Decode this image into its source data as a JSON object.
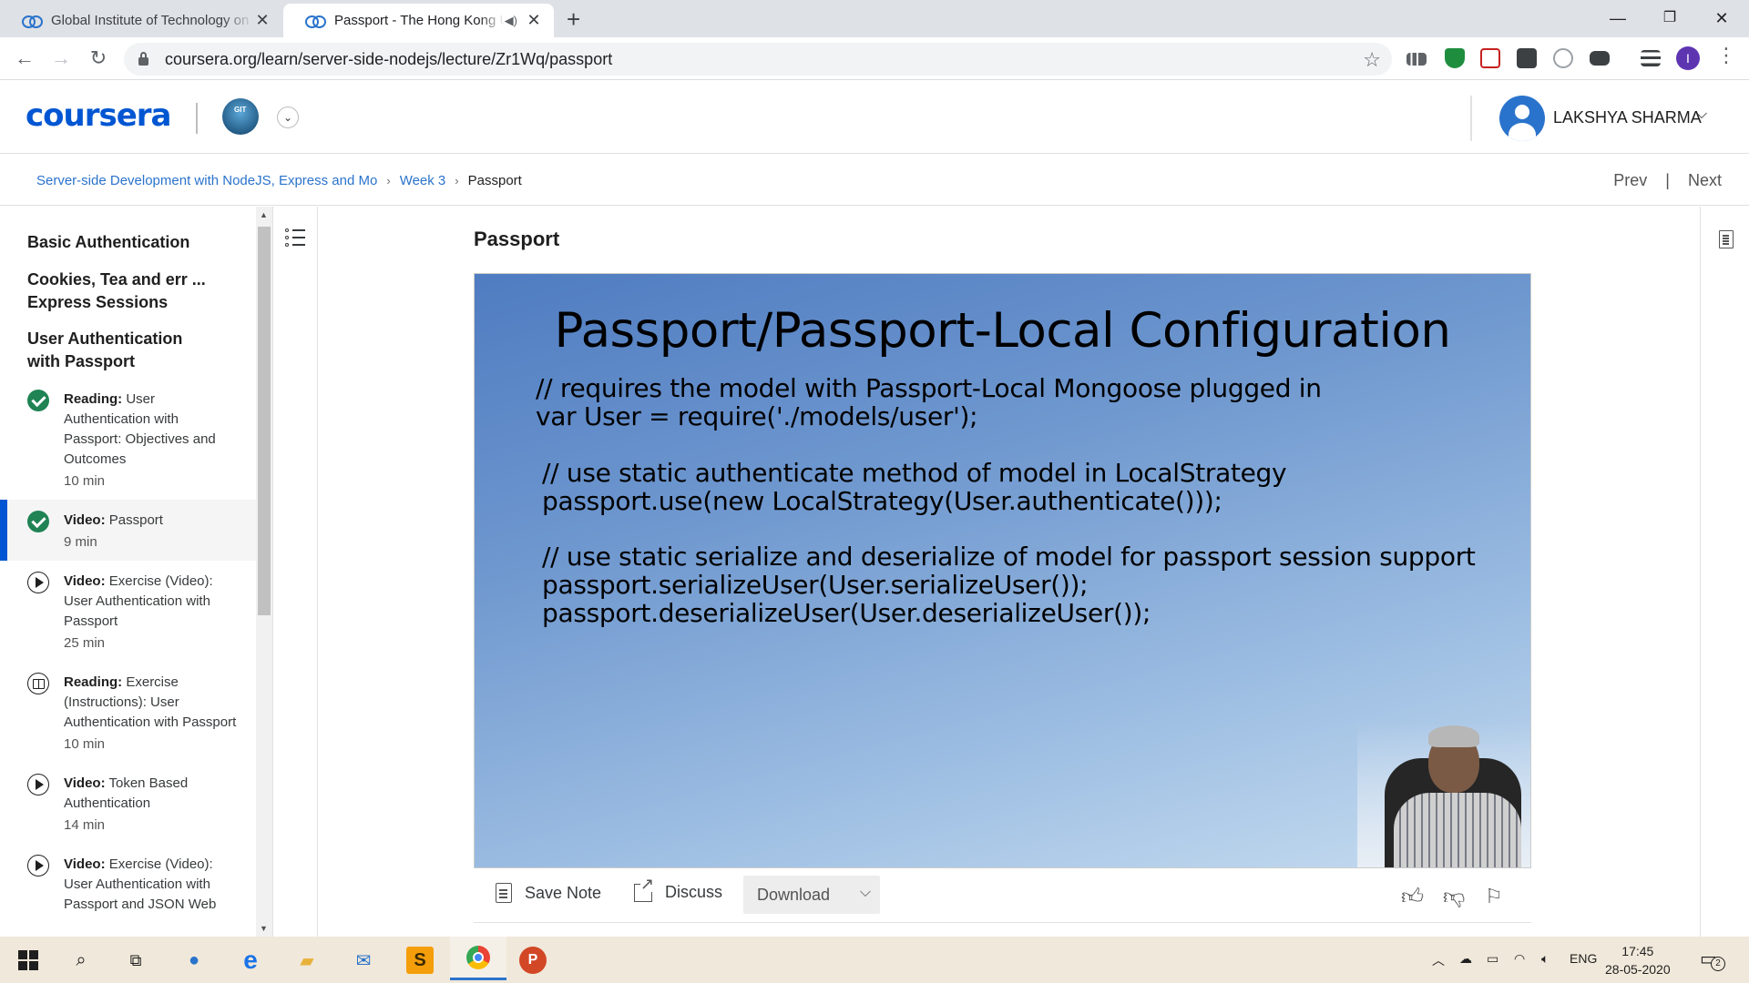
{
  "browser": {
    "tabs": [
      {
        "title": "Global Institute of Technology on Coursera",
        "active": false
      },
      {
        "title": "Passport - The Hong Kong University",
        "active": true,
        "audio": true
      }
    ],
    "url": "coursera.org/learn/server-side-nodejs/lecture/Zr1Wq/passport",
    "profile_initial": "I"
  },
  "header": {
    "logo": "coursera",
    "institution_abbr": "GIT",
    "user_name": "LAKSHYA SHARMA"
  },
  "breadcrumb": {
    "course": "Server-side Development with NodeJS, Express and Mo",
    "week": "Week 3",
    "current": "Passport",
    "prev": "Prev",
    "next": "Next"
  },
  "sidebar": {
    "sections": [
      {
        "title": "Basic Authentication"
      },
      {
        "title": "Cookies, Tea and err ... Express Sessions"
      },
      {
        "title": "User Authentication with Passport"
      }
    ],
    "items": [
      {
        "type": "Reading:",
        "title": "User Authentication with Passport: Objectives and Outcomes",
        "duration": "10 min",
        "status": "done"
      },
      {
        "type": "Video:",
        "title": "Passport",
        "duration": "9 min",
        "status": "done"
      },
      {
        "type": "Video:",
        "title": "Exercise (Video): User Authentication with Passport",
        "duration": "25 min",
        "status": "video"
      },
      {
        "type": "Reading:",
        "title": "Exercise (Instructions): User Authentication with Passport",
        "duration": "10 min",
        "status": "reading"
      },
      {
        "type": "Video:",
        "title": "Token Based Authentication",
        "duration": "14 min",
        "status": "video"
      },
      {
        "type": "Video:",
        "title": "Exercise (Video): User Authentication with Passport and JSON Web",
        "duration": "",
        "status": "video"
      }
    ]
  },
  "lecture": {
    "title": "Passport",
    "slide": {
      "heading": "Passport/Passport-Local Configuration",
      "lines": [
        "// requires the model with Passport-Local Mongoose plugged in",
        "var User = require('./models/user');",
        "// use static authenticate method of model in LocalStrategy",
        "passport.use(new LocalStrategy(User.authenticate()));",
        "// use static serialize and deserialize of model for passport session support",
        "passport.serializeUser(User.serializeUser());",
        "passport.deserializeUser(User.deserializeUser());"
      ]
    },
    "actions": {
      "save_note": "Save Note",
      "discuss": "Discuss",
      "download": "Download"
    }
  },
  "taskbar": {
    "language": "ENG",
    "time": "17:45",
    "date": "28-05-2020",
    "notifications": "2"
  },
  "colors": {
    "coursera_blue": "#0056d2",
    "link_blue": "#2a73cc",
    "complete_green": "#1f8354"
  }
}
